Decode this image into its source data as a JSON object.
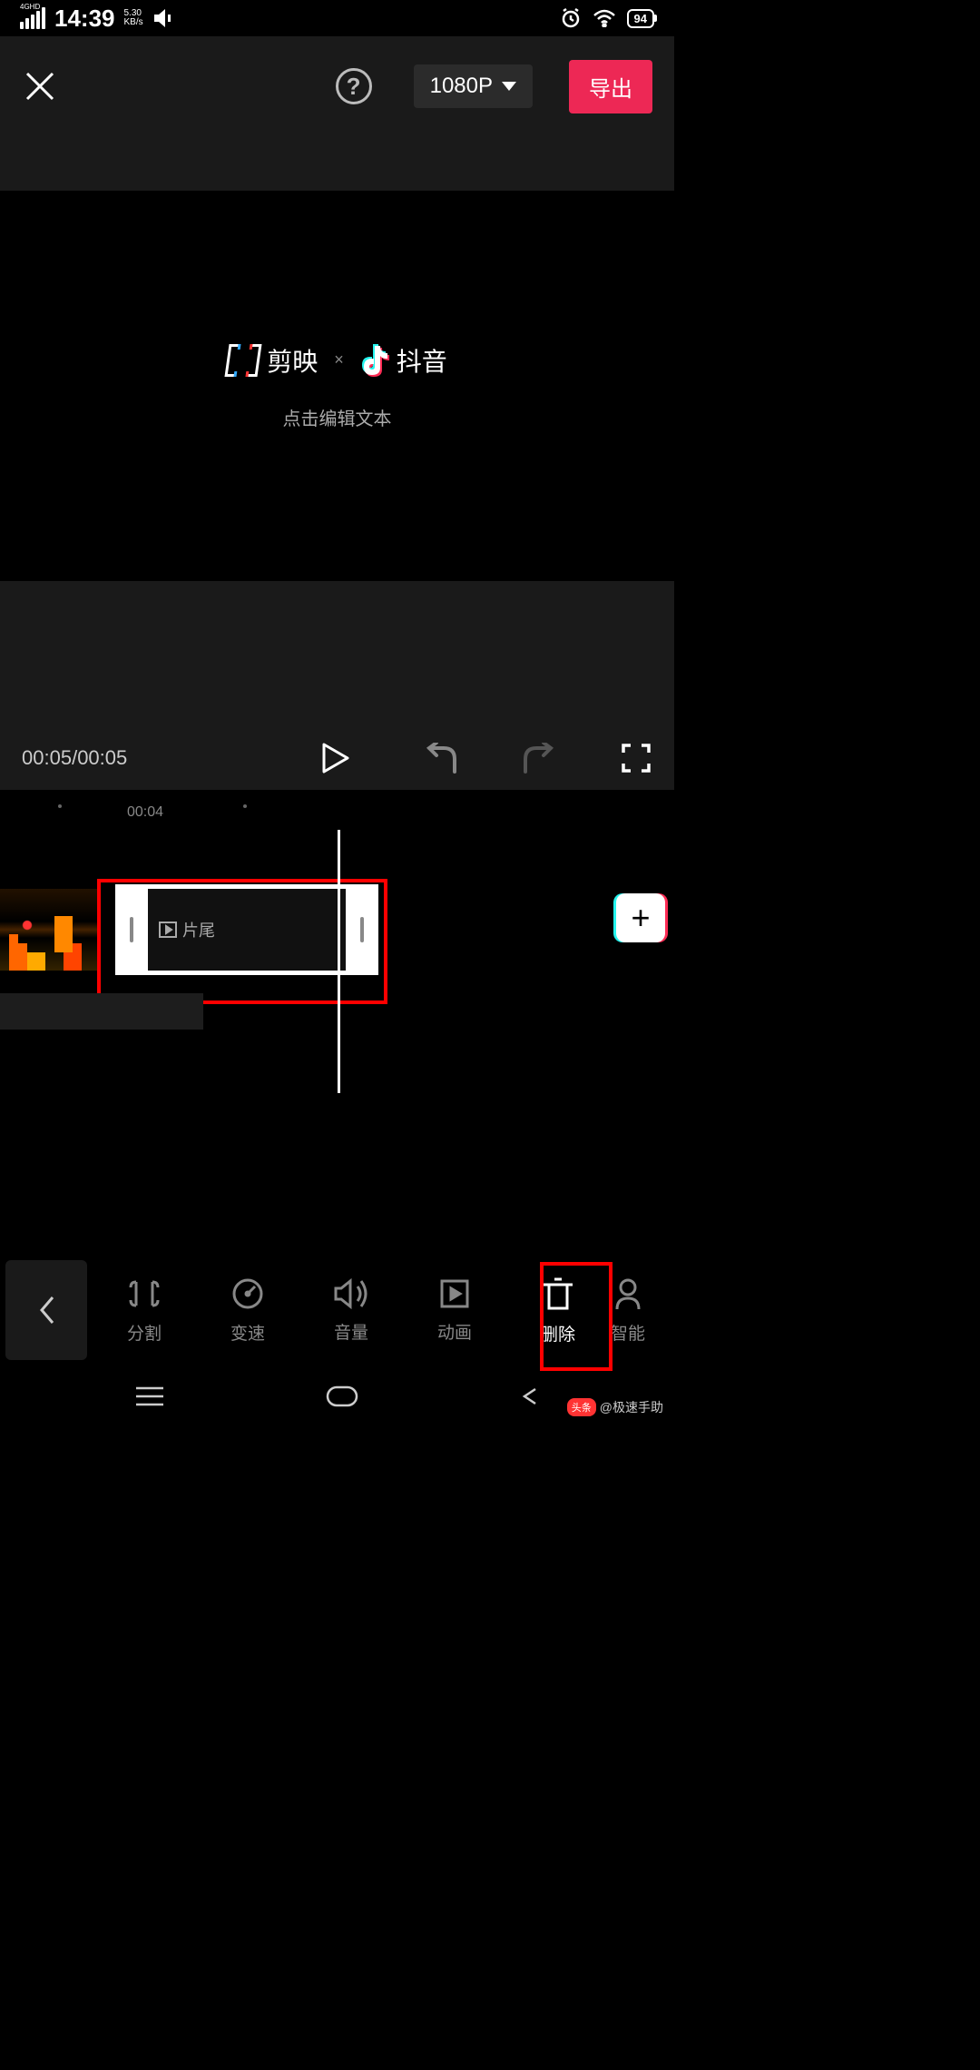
{
  "status": {
    "network": "4GHD",
    "time": "14:39",
    "speed_value": "5.30",
    "speed_unit": "KB/s",
    "battery": "94"
  },
  "header": {
    "resolution": "1080P",
    "export": "导出"
  },
  "preview": {
    "app1": "剪映",
    "separator": "×",
    "app2": "抖音",
    "hint": "点击编辑文本"
  },
  "playback": {
    "current": "00:05",
    "total": "00:05"
  },
  "ruler": {
    "marker": "00:04"
  },
  "clip": {
    "label": "片尾"
  },
  "tools": {
    "split": "分割",
    "speed": "变速",
    "volume": "音量",
    "animation": "动画",
    "delete": "删除",
    "smart": "智能"
  },
  "watermark": {
    "badge": "头条",
    "author": "@极速手助"
  }
}
